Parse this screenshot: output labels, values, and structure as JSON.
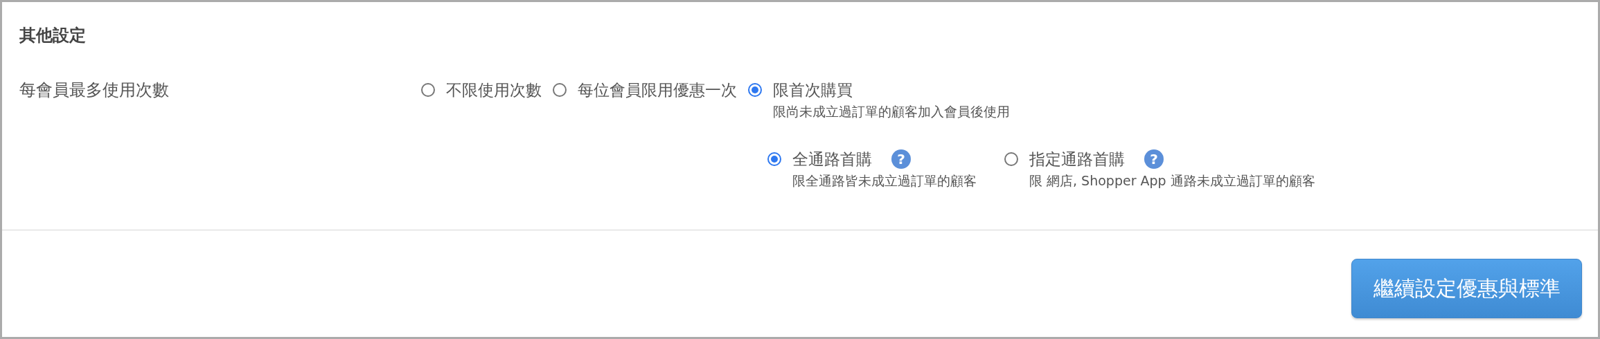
{
  "section_title": "其他設定",
  "field": {
    "label": "每會員最多使用次數",
    "options": [
      {
        "label": "不限使用次數",
        "selected": false
      },
      {
        "label": "每位會員限用優惠一次",
        "selected": false
      },
      {
        "label": "限首次購買",
        "selected": true,
        "description": "限尚未成立過訂單的顧客加入會員後使用",
        "children": [
          {
            "label": "全通路首購",
            "selected": true,
            "help": "?",
            "description": "限全通路皆未成立過訂單的顧客"
          },
          {
            "label": "指定通路首購",
            "selected": false,
            "help": "?",
            "description": "限 網店, Shopper App 通路未成立過訂單的顧客"
          }
        ]
      }
    ]
  },
  "button": "繼續設定優惠與標準"
}
